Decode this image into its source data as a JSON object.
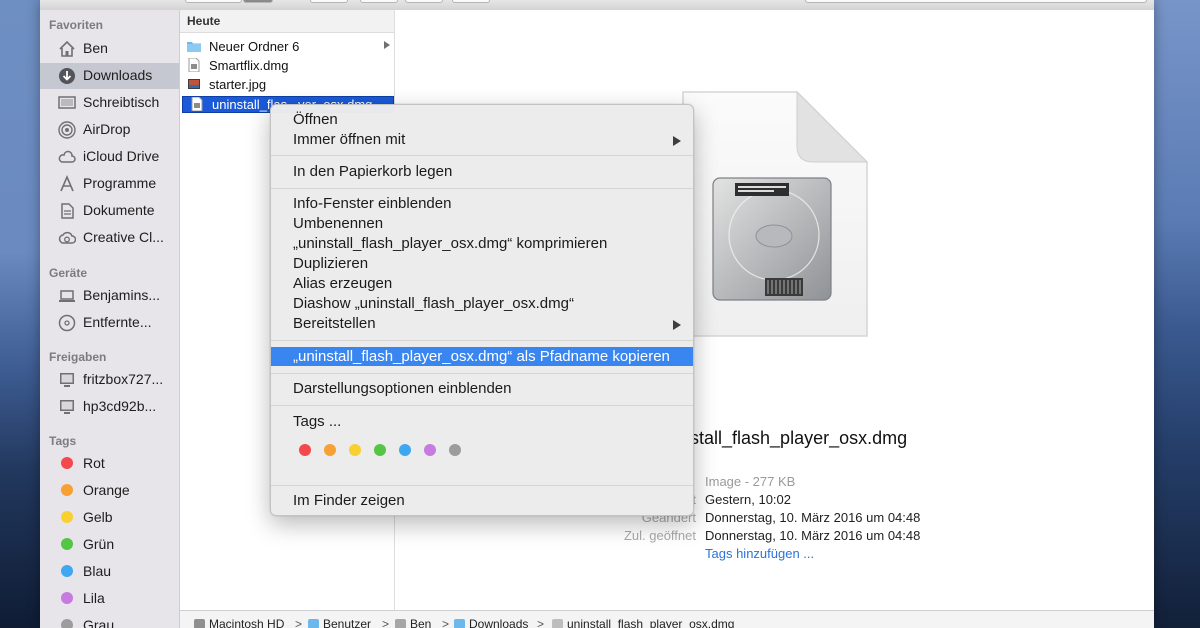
{
  "sidebar": {
    "sections": {
      "favorites": "Favoriten",
      "devices": "Geräte",
      "shared": "Freigaben",
      "tags": "Tags"
    },
    "favorites": [
      {
        "label": "Ben",
        "icon": "home-icon"
      },
      {
        "label": "Downloads",
        "icon": "downloads-icon"
      },
      {
        "label": "Schreibtisch",
        "icon": "desktop-icon"
      },
      {
        "label": "AirDrop",
        "icon": "airdrop-icon"
      },
      {
        "label": "iCloud Drive",
        "icon": "cloud-icon"
      },
      {
        "label": "Programme",
        "icon": "applications-icon"
      },
      {
        "label": "Dokumente",
        "icon": "documents-icon"
      },
      {
        "label": "Creative Cl...",
        "icon": "creative-cloud-icon"
      }
    ],
    "devices": [
      {
        "label": "Benjamins...",
        "icon": "laptop-icon"
      },
      {
        "label": "Entfernte...",
        "icon": "remote-disc-icon"
      }
    ],
    "shared": [
      {
        "label": "fritzbox727...",
        "icon": "monitor-icon"
      },
      {
        "label": "hp3cd92b...",
        "icon": "monitor-icon"
      }
    ],
    "tags": [
      {
        "label": "Rot",
        "color": "#f4484d"
      },
      {
        "label": "Orange",
        "color": "#f7a033"
      },
      {
        "label": "Gelb",
        "color": "#f8d030"
      },
      {
        "label": "Grün",
        "color": "#54c545"
      },
      {
        "label": "Blau",
        "color": "#3ea7f0"
      },
      {
        "label": "Lila",
        "color": "#c77ae0"
      },
      {
        "label": "Grau",
        "color": "#9c9c9c"
      }
    ]
  },
  "file_list": {
    "header": "Heute",
    "items": [
      {
        "label": "Neuer Ordner 6",
        "icon": "folder-icon"
      },
      {
        "label": "Smartflix.dmg",
        "icon": "dmg-file-icon"
      },
      {
        "label": "starter.jpg",
        "icon": "image-file-icon"
      },
      {
        "label": "uninstall_flas...yer_osx.dmg",
        "icon": "dmg-file-icon"
      }
    ]
  },
  "preview": {
    "filename": "stall_flash_player_osx.dmg",
    "meta": {
      "kind_value": "Image - 277 KB",
      "created_label": "t",
      "created_value": "Gestern, 10:02",
      "modified_label": "Geändert",
      "modified_value": "Donnerstag, 10. März 2016 um 04:48",
      "opened_label": "Zul. geöffnet",
      "opened_value": "Donnerstag, 10. März 2016 um 04:48",
      "tags_link": "Tags hinzufügen ..."
    }
  },
  "pathbar": {
    "items": [
      "Macintosh HD",
      "Benutzer",
      "Ben",
      "Downloads",
      "uninstall_flash_player_osx.dmg"
    ]
  },
  "context_menu": {
    "open": "Öffnen",
    "open_with": "Immer öffnen mit",
    "trash": "In den Papierkorb legen",
    "info": "Info-Fenster einblenden",
    "rename": "Umbenennen",
    "compress": "„uninstall_flash_player_osx.dmg“ komprimieren",
    "duplicate": "Duplizieren",
    "alias": "Alias erzeugen",
    "slideshow": "Diashow „uninstall_flash_player_osx.dmg“",
    "share": "Bereitstellen",
    "copy_path": "„uninstall_flash_player_osx.dmg“ als Pfadname kopieren",
    "view_options": "Darstellungsoptionen einblenden",
    "tags": "Tags ...",
    "tag_colors": [
      "#f4484d",
      "#f7a033",
      "#f8d030",
      "#54c545",
      "#3ea7f0",
      "#c77ae0",
      "#9c9c9c"
    ],
    "show_in_finder": "Im Finder zeigen"
  }
}
